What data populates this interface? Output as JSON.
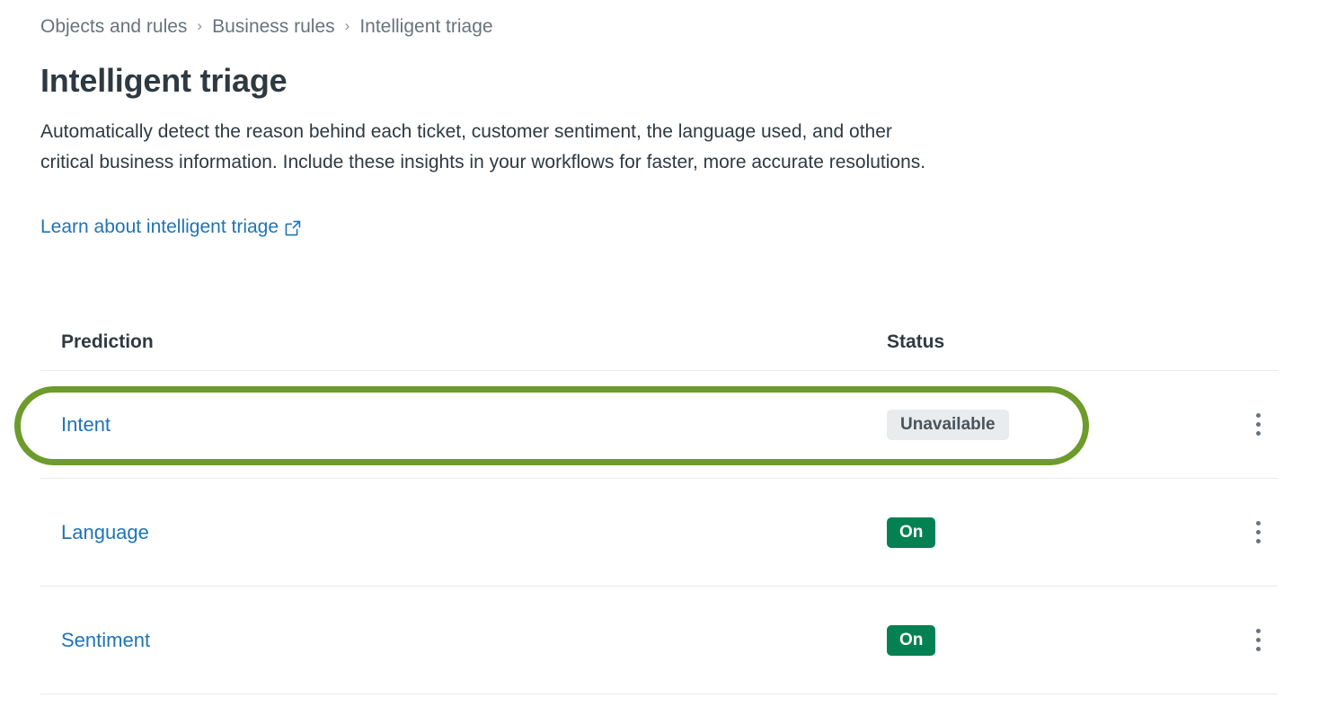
{
  "breadcrumb": {
    "items": [
      {
        "label": "Objects and rules",
        "current": false
      },
      {
        "label": "Business rules",
        "current": false
      },
      {
        "label": "Intelligent triage",
        "current": true
      }
    ],
    "separator": "›"
  },
  "page": {
    "title": "Intelligent triage",
    "description": "Automatically detect the reason behind each ticket, customer sentiment, the language used, and other critical business information. Include these insights in your workflows for faster, more accurate resolutions.",
    "learn_link_label": "Learn about intelligent triage",
    "learn_link_icon": "external-link-icon"
  },
  "table": {
    "columns": [
      {
        "key": "prediction",
        "label": "Prediction"
      },
      {
        "key": "status",
        "label": "Status"
      },
      {
        "key": "actions",
        "label": ""
      }
    ],
    "rows": [
      {
        "prediction": "Intent",
        "status": "Unavailable",
        "status_type": "unavailable",
        "actions_icon": "kebab-menu-icon",
        "highlighted": true
      },
      {
        "prediction": "Language",
        "status": "On",
        "status_type": "on",
        "actions_icon": "kebab-menu-icon",
        "highlighted": false
      },
      {
        "prediction": "Sentiment",
        "status": "On",
        "status_type": "on",
        "actions_icon": "kebab-menu-icon",
        "highlighted": false
      }
    ]
  },
  "annotation": {
    "target": "Intent",
    "shape": "rounded-rectangle",
    "color": "#6d9b2c"
  },
  "colors": {
    "link": "#1f73b7",
    "text": "#2f3941",
    "muted": "#68737d",
    "divider": "#e9ebed",
    "badge_on_bg": "#038153",
    "badge_unavailable_bg": "#e9ebed",
    "annotation_green": "#6d9b2c"
  }
}
